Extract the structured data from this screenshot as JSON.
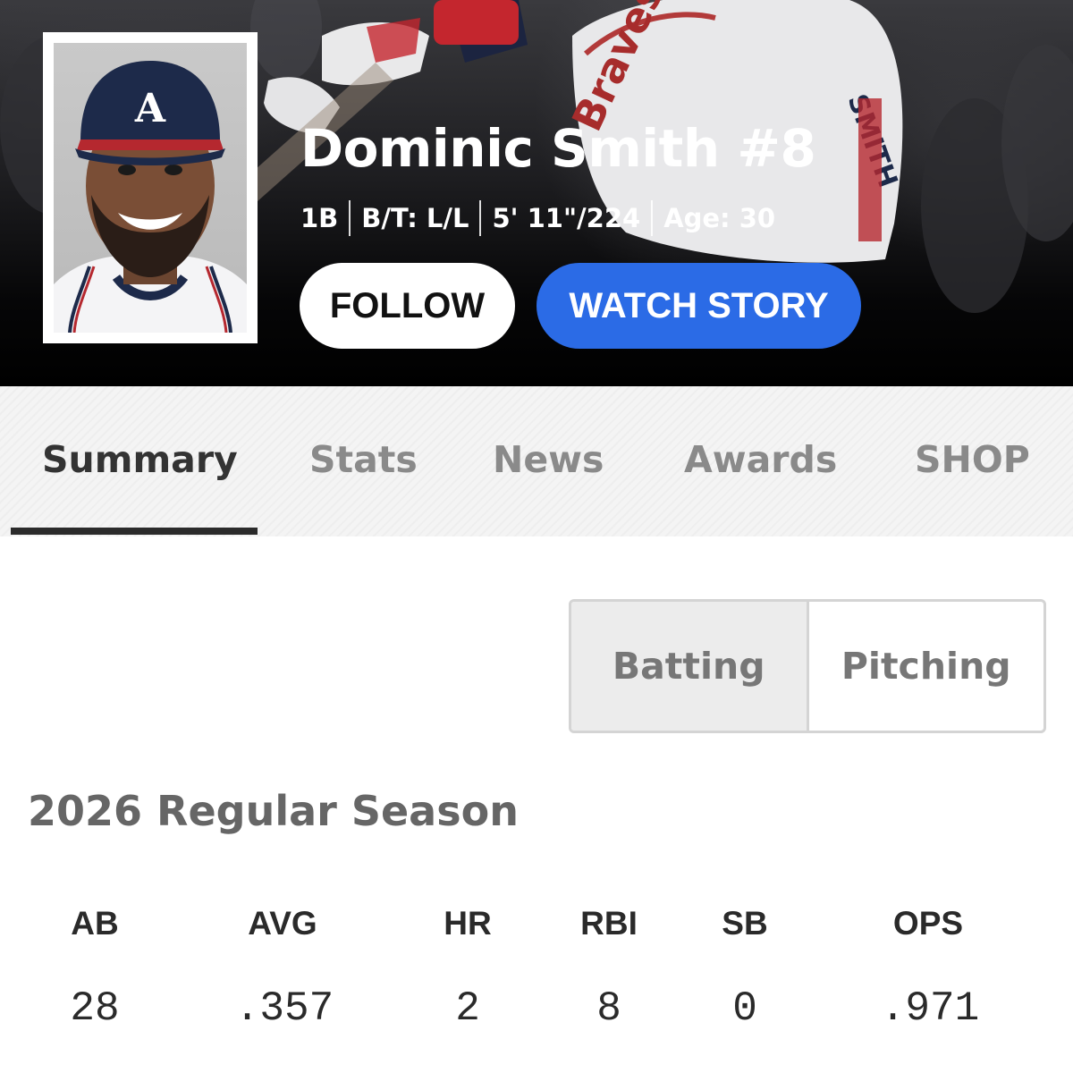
{
  "player": {
    "name": "Dominic Smith #8",
    "bio": [
      "1B",
      "B/T: L/L",
      "5' 11\"/224",
      "Age: 30"
    ],
    "cap_logo_letter": "A",
    "jersey_back_lettering": "SMITH",
    "jersey_front_lettering": "Braves"
  },
  "actions": {
    "follow_label": "FOLLOW",
    "watch_label": "WATCH STORY",
    "watch_color": "#2b6be6"
  },
  "tabs": [
    {
      "label": "Summary",
      "active": true
    },
    {
      "label": "Stats",
      "active": false
    },
    {
      "label": "News",
      "active": false
    },
    {
      "label": "Awards",
      "active": false
    },
    {
      "label": "SHOP",
      "active": false
    }
  ],
  "toggle": {
    "options": [
      "Batting",
      "Pitching"
    ],
    "selected": "Batting"
  },
  "season": {
    "title": "2026 Regular Season",
    "stats": [
      {
        "label": "AB",
        "value": "28"
      },
      {
        "label": "AVG",
        "value": ".357"
      },
      {
        "label": "HR",
        "value": "2"
      },
      {
        "label": "RBI",
        "value": "8"
      },
      {
        "label": "SB",
        "value": "0"
      },
      {
        "label": "OPS",
        "value": ".971"
      }
    ]
  }
}
